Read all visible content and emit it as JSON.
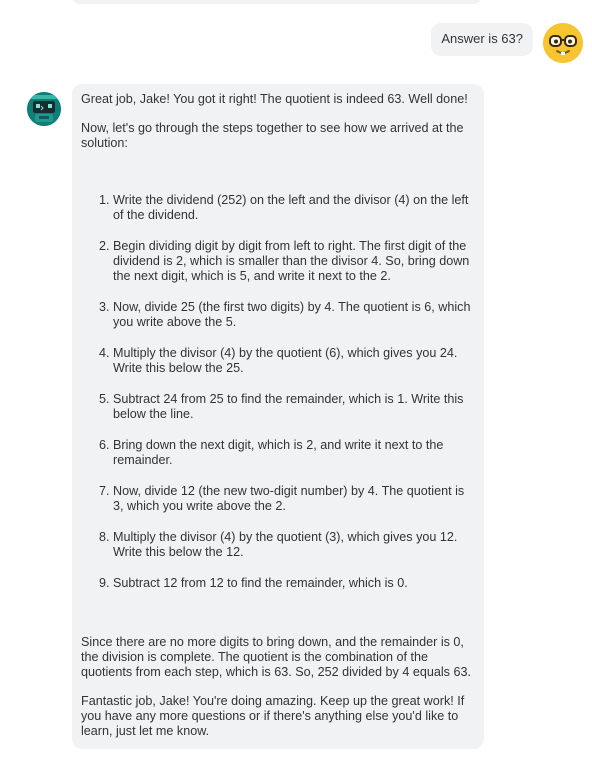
{
  "user_message": {
    "text": "Answer is 63?",
    "avatar_icon": "nerd-glasses-emoji-icon"
  },
  "bot_message": {
    "avatar_icon": "robot-icon",
    "greeting": "Great job, Jake! You got it right! The quotient is indeed 63. Well done!",
    "intro": "Now, let's go through the steps together to see how we arrived at the solution:",
    "steps": [
      "Write the dividend (252) on the left and the divisor (4) on the left of the dividend.",
      "Begin dividing digit by digit from left to right. The first digit of the dividend is 2, which is smaller than the divisor 4. So, bring down the next digit, which is 5, and write it next to the 2.",
      "Now, divide 25 (the first two digits) by 4. The quotient is 6, which you write above the 5.",
      "Multiply the divisor (4) by the quotient (6), which gives you 24. Write this below the 25.",
      "Subtract 24 from 25 to find the remainder, which is 1. Write this below the line.",
      "Bring down the next digit, which is 2, and write it next to the remainder.",
      "Now, divide 12 (the new two-digit number) by 4. The quotient is 3, which you write above the 2.",
      "Multiply the divisor (4) by the quotient (3), which gives you 12. Write this below the 12.",
      "Subtract 12 from 12 to find the remainder, which is 0."
    ],
    "conclusion": "Since there are no more digits to bring down, and the remainder is 0, the division is complete. The quotient is the combination of the quotients from each step, which is 63. So, 252 divided by 4 equals 63.",
    "closing": "Fantastic job, Jake! You're doing amazing. Keep up the great work! If you have any more questions or if there's anything else you'd like to learn, just let me know."
  },
  "colors": {
    "bubble_bg": "#f1f2f4",
    "text": "#333333",
    "bot_avatar_bg": "#0d7f78",
    "user_avatar_bg": "#f7c531"
  }
}
